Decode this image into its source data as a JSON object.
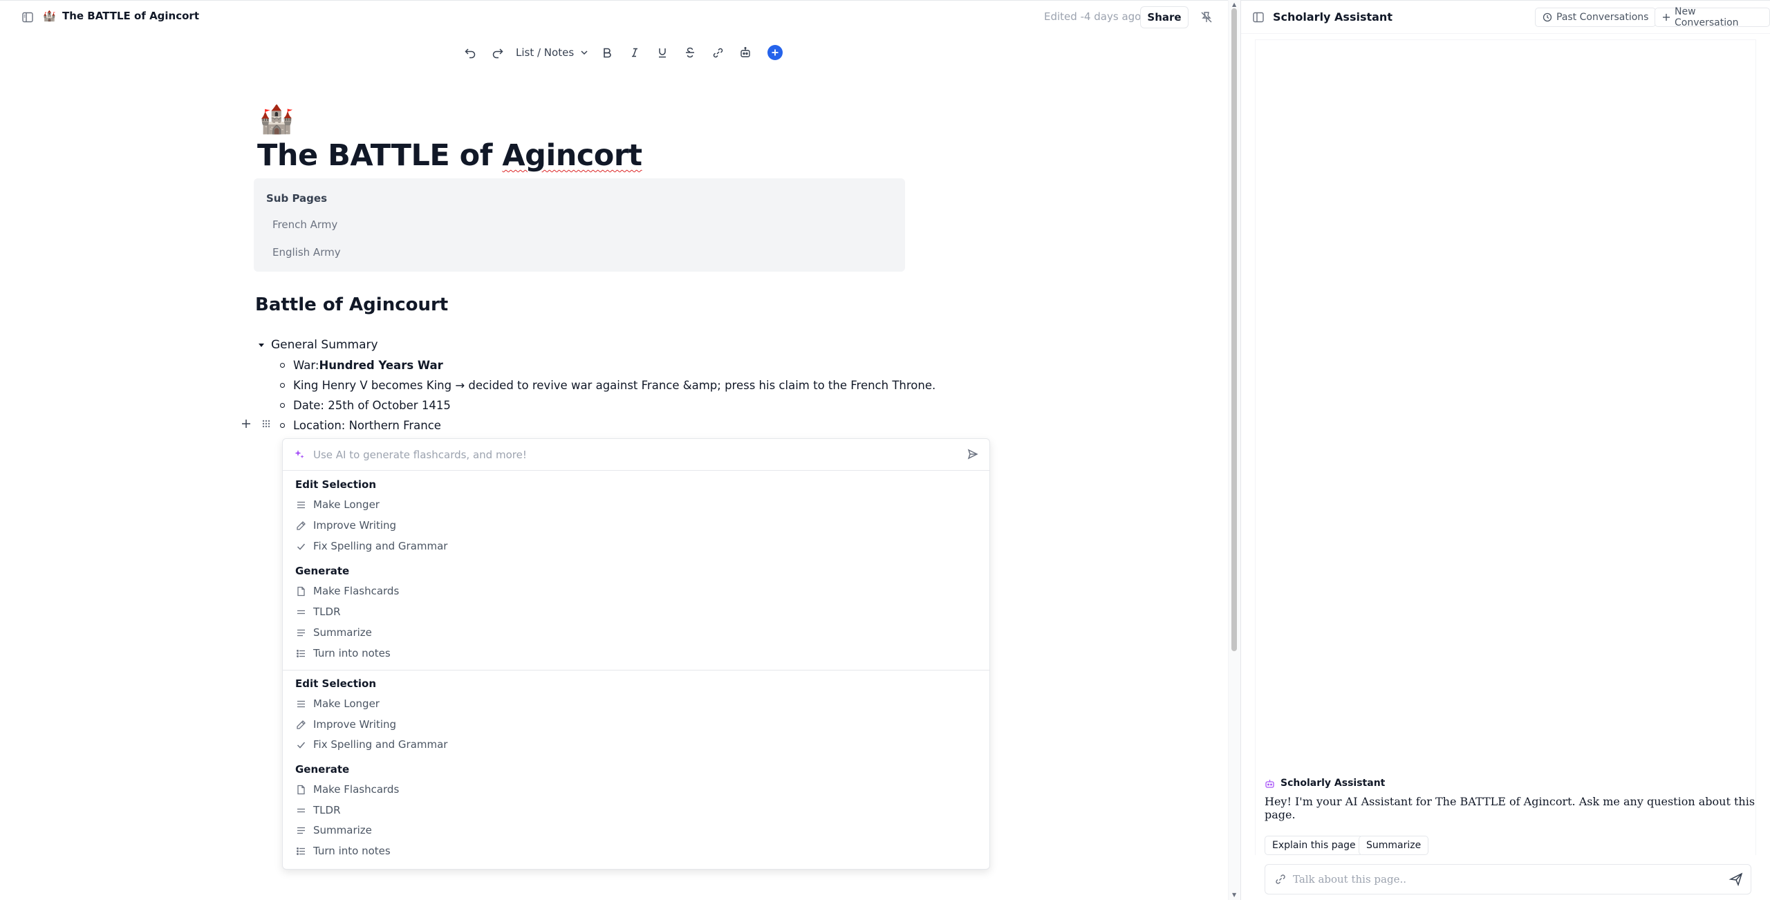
{
  "topbar": {
    "page_emoji": "🏰",
    "page_title": "The BATTLE of Agincort",
    "edited": "Edited -4 days ago",
    "share_label": "Share"
  },
  "toolbar": {
    "block_type": "List / Notes"
  },
  "document": {
    "emoji": "🏰",
    "title_pre": "The BATTLE of ",
    "title_misspelled": "Agincort",
    "subpages": {
      "title": "Sub Pages",
      "items": [
        "French Army",
        "English Army"
      ]
    },
    "heading": "Battle of Agincourt",
    "toggle_label": "General Summary",
    "bullets": [
      {
        "prefix": "War: ",
        "bold": "Hundred Years War",
        "suffix": ""
      },
      {
        "prefix": "King Henry V becomes King → decided to revive war against France &amp; press his claim to the French Throne.",
        "bold": "",
        "suffix": ""
      },
      {
        "prefix": "Date: 25th of October 1415",
        "bold": "",
        "suffix": ""
      },
      {
        "prefix": "Location: Northern France",
        "bold": "",
        "suffix": ""
      }
    ]
  },
  "ai_menu": {
    "placeholder": "Use AI to generate flashcards, and more!",
    "sections": [
      {
        "heading": "Edit Selection",
        "items": [
          {
            "label": "Make Longer",
            "icon": "lines-icon"
          },
          {
            "label": "Improve Writing",
            "icon": "pencil-icon"
          },
          {
            "label": "Fix Spelling and Grammar",
            "icon": "check-icon"
          }
        ]
      },
      {
        "heading": "Generate",
        "items": [
          {
            "label": "Make Flashcards",
            "icon": "file-icon"
          },
          {
            "label": "TLDR",
            "icon": "equals-icon"
          },
          {
            "label": "Summarize",
            "icon": "lines-icon"
          },
          {
            "label": "Turn into notes",
            "icon": "list-icon"
          }
        ]
      },
      {
        "heading": "Edit Selection",
        "items": [
          {
            "label": "Make Longer",
            "icon": "lines-icon"
          },
          {
            "label": "Improve Writing",
            "icon": "pencil-icon"
          },
          {
            "label": "Fix Spelling and Grammar",
            "icon": "check-icon"
          }
        ]
      },
      {
        "heading": "Generate",
        "items": [
          {
            "label": "Make Flashcards",
            "icon": "file-icon"
          },
          {
            "label": "TLDR",
            "icon": "equals-icon"
          },
          {
            "label": "Summarize",
            "icon": "lines-icon"
          },
          {
            "label": "Turn into notes",
            "icon": "list-icon"
          }
        ]
      }
    ]
  },
  "assistant": {
    "title": "Scholarly Assistant",
    "past_label": "Past Conversations",
    "new_label": "New Conversation",
    "bot_name": "Scholarly Assistant",
    "message": "Hey! I'm your AI Assistant for The BATTLE of Agincort. Ask me any question about this page.",
    "chips": [
      "Explain this page",
      "Summarize"
    ],
    "input_placeholder": "Talk about this page.."
  },
  "colors": {
    "accent": "#2563eb",
    "ai_purple": "#a855f7",
    "subpages_bg": "#f3f4f6"
  }
}
